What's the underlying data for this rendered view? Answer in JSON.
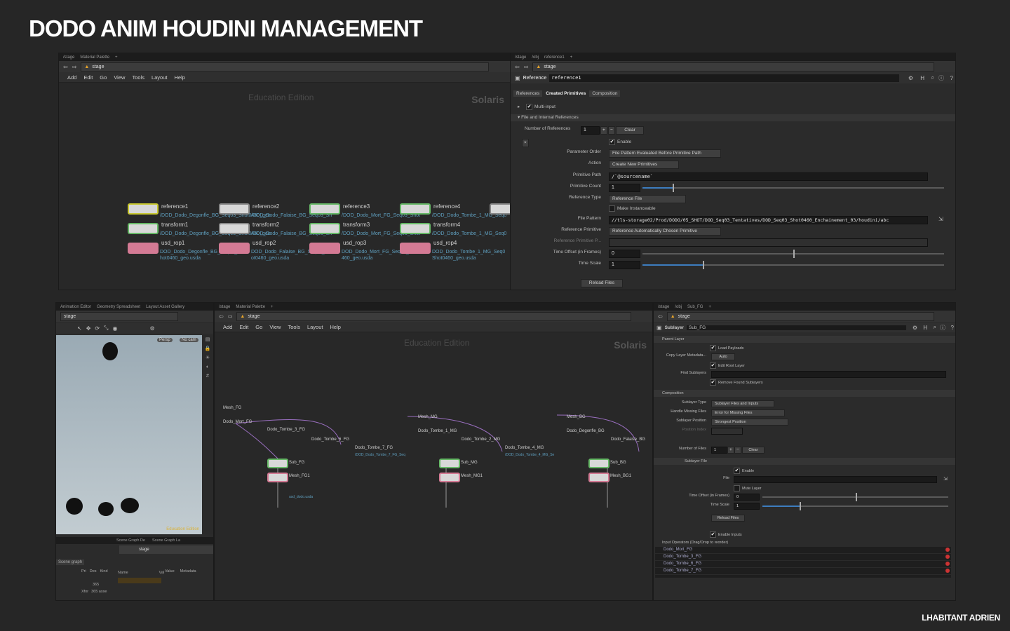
{
  "headline": "DODO ANIM HOUDINI MANAGEMENT",
  "credit": "LHABITANT ADRIEN",
  "top_left_pane": {
    "tabs": [
      "/stage",
      "Material Palette"
    ],
    "path": "stage",
    "menu": [
      "Add",
      "Edit",
      "Go",
      "View",
      "Tools",
      "Layout",
      "Help"
    ],
    "watermark": "Education Edition",
    "context_label": "Solaris",
    "nodes": [
      {
        "name": "reference1",
        "file": "/DOD_Dodo_Degonfle_BG_Seq03_Shot0460_geo",
        "xform": "transform1",
        "xform_file": "/DOD_Dodo_Degonfle_BG_Seq03_Shot0460_geo",
        "rop": "usd_rop1",
        "rop_file1": "DOD_Dodo_Degonfle_BG_Seq03_S",
        "rop_file2": "hot0460_geo.usda"
      },
      {
        "name": "reference2",
        "file": "/DOD_Dodo_Falaise_BG_Seq03_Sh",
        "xform": "transform2",
        "xform_file": "/DOD_Dodo_Falaise_BG_Seq03_Sh",
        "rop": "usd_rop2",
        "rop_file1": "DOD_Dodo_Falaise_BG_Seq03_Sh",
        "rop_file2": "ot0460_geo.usda"
      },
      {
        "name": "reference3",
        "file": "/DOD_Dodo_Mort_FG_Seq03_Shot",
        "xform": "transform3",
        "xform_file": "/DOD_Dodo_Mort_FG_Seq03_Shot",
        "rop": "usd_rop3",
        "rop_file1": "DOD_Dodo_Mort_FG_Seq03_Shot0",
        "rop_file2": "460_geo.usda"
      },
      {
        "name": "reference4",
        "file": "/DOD_Dodo_Tombe_1_MG_Seq0",
        "xform": "transform4",
        "xform_file": "/DOD_Dodo_Tombe_1_MG_Seq0",
        "rop": "usd_rop4",
        "rop_file1": "DOD_Dodo_Tombe_1_MG_Seq0",
        "rop_file2": "Shot0460_geo.usda"
      }
    ]
  },
  "top_right_pane": {
    "tabs": [
      "/stage",
      "/obj",
      "reference1"
    ],
    "path": "stage",
    "node_type": "Reference",
    "node_name": "reference1",
    "subtabs": [
      "References",
      "Created Primitives",
      "Composition"
    ],
    "multi_input": "Multi-input",
    "section": "File and Internal References",
    "num_refs_label": "Number of References",
    "num_refs_value": "1",
    "clear_label": "Clear",
    "enable_label": "Enable",
    "parameter_order_label": "Parameter Order",
    "parameter_order_value": "File Pattern Evaluated Before Primitive Path",
    "action_label": "Action",
    "action_value": "Create New Primitives",
    "primitive_path_label": "Primitive Path",
    "primitive_path_value": "/`@sourcename`",
    "primitive_count_label": "Primitive Count",
    "primitive_count_value": "1",
    "reference_type_label": "Reference Type",
    "reference_type_value": "Reference File",
    "make_instanceable_label": "Make Instanceable",
    "file_pattern_label": "File Pattern",
    "file_pattern_value": "//tls-storage02/Prod/DODO/05_SHOT/DOD_Seq03_Tentatives/DOD_Seq03_Shot0460_Enchainement_03/houdini/abc",
    "reference_primitive_label": "Reference Primitive",
    "reference_primitive_value": "Reference Automatically Chosen Primitive",
    "reference_primitive_path_label": "Reference Primitive P...",
    "time_offset_label": "Time Offset (in Frames)",
    "time_offset_value": "0",
    "time_scale_label": "Time Scale",
    "time_scale_value": "1",
    "reload_label": "Reload Files"
  },
  "bottom_left_pane": {
    "tabs": [
      "Animation Editor",
      "Geometry Spreadsheet",
      "Layout Asset Gallery"
    ],
    "path": "stage",
    "persp": "Persp",
    "cam": "No cam",
    "edu": "Education Edition",
    "scene_tabs": [
      "Scene Graph De",
      "Scene Graph La"
    ],
    "scene_path": "stage",
    "scene_graph": "Scene graph",
    "cols_left": [
      "Pri",
      "Des",
      "Kind"
    ],
    "cols_right": [
      "Name",
      "Val",
      "Value",
      "Metadata"
    ],
    "row1": "365",
    "row2_a": "Xfor",
    "row2_b": "365 asse"
  },
  "bottom_mid_pane": {
    "tabs": [
      "/stage",
      "Material Palette"
    ],
    "path": "stage",
    "menu": [
      "Add",
      "Edit",
      "Go",
      "View",
      "Tools",
      "Layout",
      "Help"
    ],
    "watermark": "Education Edition",
    "context_label": "Solaris",
    "nodes": [
      "Mesh_FG",
      "Dodo_Mort_FG",
      "Dodo_Tombe_3_FG",
      "Dodo_Tombe_6_FG",
      "Dodo_Tombe_7_FG",
      "Sub_FG",
      "Mesh_FG1",
      "Mesh_MG",
      "Dodo_Tombe_1_MG",
      "Dodo_Tombe_2_MG",
      "Dodo_Tombe_4_MG",
      "Sub_MG",
      "Mesh_MG1",
      "Mesh_BG",
      "Dodo_Degonfle_BG",
      "Dodo_Falaise_BG",
      "Sub_BG",
      "Mesh_BG1"
    ],
    "subs": [
      "/DOD_Dodo_Tombe_7_FG_Seq",
      "/DOD_Dodo_Tombe_4_MG_Se",
      "usd_dodo.usda"
    ]
  },
  "bottom_right_pane": {
    "tabs": [
      "/stage",
      "/obj",
      "Sub_FG"
    ],
    "path": "stage",
    "node_type": "Sublayer",
    "node_name": "Sub_FG",
    "parent_layer": "Parent Layer",
    "load_payloads": "Load Payloads",
    "copy_layer_label": "Copy Layer Metadata...",
    "copy_layer_value": "Auto",
    "edit_root_layer": "Edit Root Layer",
    "find_sublayers": "Find Sublayers",
    "remove_found": "Remove Found Sublayers",
    "composition": "Composition",
    "sublayer_type_label": "Sublayer Type",
    "sublayer_type_value": "Sublayer Files and Inputs",
    "missing_label": "Handle Missing Files",
    "missing_value": "Error for Missing Files",
    "position_label": "Sublayer Position",
    "position_value": "Strongest Position",
    "position_index": "Position Index",
    "num_files_label": "Number of Files",
    "num_files_value": "1",
    "clear_label": "Clear",
    "sublayer_file": "Sublayer File",
    "enable": "Enable",
    "file_label": "File",
    "mute_layer": "Mute Layer",
    "time_offset_label": "Time Offset (in Frames)",
    "time_offset_value": "0",
    "time_scale_label": "Time Scale",
    "time_scale_value": "1",
    "reload_label": "Reload Files",
    "enable_inputs": "Enable Inputs",
    "input_ops_label": "Input Operators (Drag/Drop to reorder)",
    "inputs": [
      "Dodo_Mort_FG",
      "Dodo_Tombe_3_FG",
      "Dodo_Tombe_6_FG",
      "Dodo_Tombe_7_FG"
    ]
  },
  "colors": {
    "accent": "#3d7dbf",
    "node_ref": "#c8c830",
    "node_xform": "#66b866",
    "node_rop": "#d47a94",
    "node_sub": "#b066c6"
  }
}
